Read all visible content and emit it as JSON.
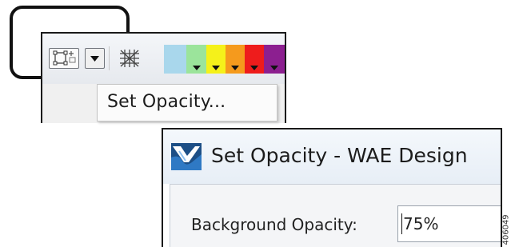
{
  "toolbar": {
    "icons": [
      "shape-tool-icon",
      "dropdown-arrow-icon",
      "grid-icon"
    ],
    "colors": [
      {
        "name": "light-blue",
        "hex": "#a9d7ec",
        "has_arrow": false
      },
      {
        "name": "light-green",
        "hex": "#9be49b",
        "has_arrow": true
      },
      {
        "name": "yellow",
        "hex": "#f5f11a",
        "has_arrow": true
      },
      {
        "name": "orange",
        "hex": "#f59a1d",
        "has_arrow": true
      },
      {
        "name": "red",
        "hex": "#ee1c1c",
        "has_arrow": true
      },
      {
        "name": "purple",
        "hex": "#8c1f90",
        "has_arrow": true
      }
    ]
  },
  "context_menu": {
    "items": [
      {
        "label": "Set Opacity..."
      }
    ]
  },
  "dialog": {
    "title": "Set Opacity - WAE Design",
    "icon": "wae-design-app-icon",
    "field_label": "Background Opacity:",
    "field_value": "75%"
  },
  "figure_id": "406049"
}
